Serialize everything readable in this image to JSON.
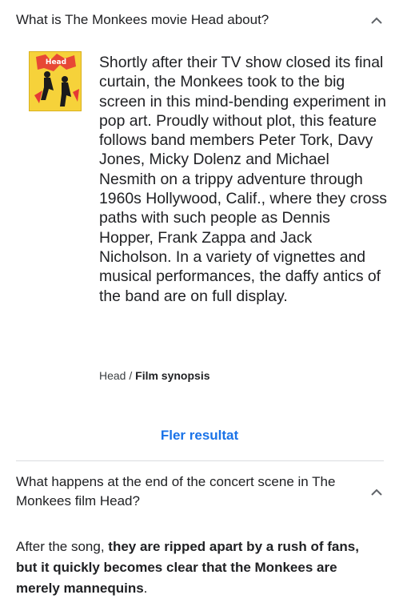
{
  "q1": {
    "question": "What is The Monkees movie Head about?",
    "answer": "Shortly after their TV show closed its final curtain, the Monkees took to the big screen in this mind-bending experiment in pop art. Proudly without plot, this feature follows band members Peter Tork, Davy Jones, Micky Dolenz and Michael Nesmith on a trippy adventure through 1960s Hollywood, Calif., where they cross paths with such people as Dennis Hopper, Frank Zappa and Jack Nicholson. In a variety of vignettes and musical performances, the daffy antics of the band are on full display.",
    "source_title": "Head",
    "source_sep": " / ",
    "source_type": "Film synopsis",
    "poster_logo_text": "Head"
  },
  "more_results": "Fler resultat",
  "q2": {
    "question": "What happens at the end of the concert scene in The Monkees film Head?",
    "answer_pre": "After the song, ",
    "answer_bold": "they are ripped apart by a rush of fans, but it quickly becomes clear that the Monkees are merely mannequins",
    "answer_post": "."
  },
  "icons": {
    "chevron": "chevron-up-icon"
  },
  "colors": {
    "link": "#1a73e8",
    "text": "#202124",
    "divider": "#dadce0",
    "poster_bg": "#f6d23a"
  }
}
